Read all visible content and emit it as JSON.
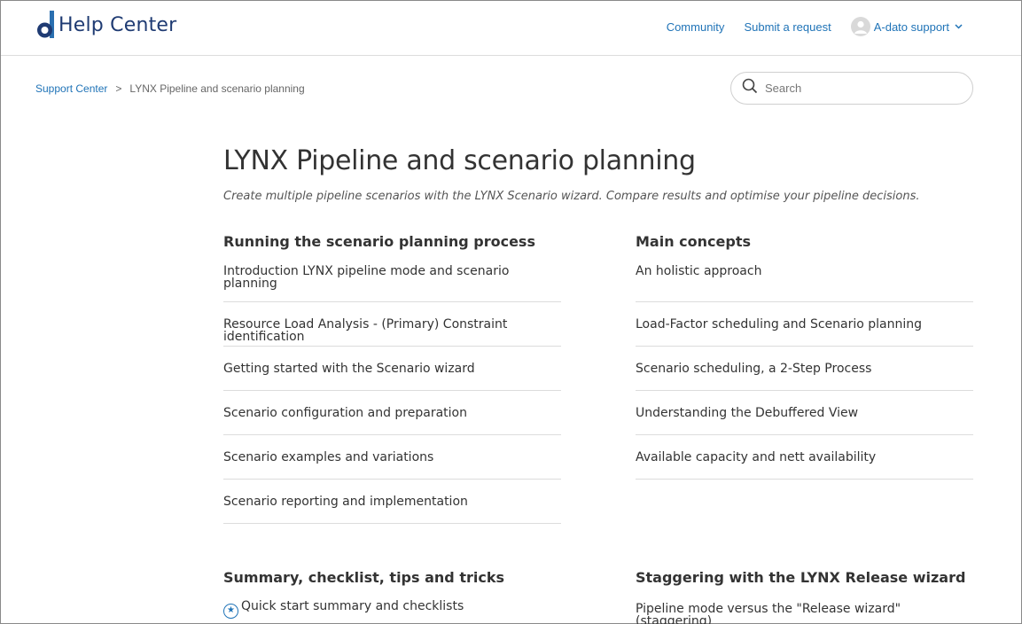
{
  "header": {
    "logo_text": "Help Center",
    "nav": {
      "community": "Community",
      "submit_request": "Submit a request",
      "user_name": "A-dato support"
    }
  },
  "breadcrumbs": {
    "home": "Support Center",
    "separator": ">",
    "current": "LYNX Pipeline and scenario planning"
  },
  "search": {
    "placeholder": "Search"
  },
  "category": {
    "title": "LYNX Pipeline and scenario planning",
    "description": "Create multiple pipeline scenarios with the LYNX Scenario wizard. Compare results and optimise your pipeline decisions."
  },
  "sections": [
    {
      "title": "Running the scenario planning process",
      "articles": [
        "Introduction LYNX pipeline mode and scenario planning",
        "Resource Load Analysis - (Primary) Constraint identification",
        "Getting started with the Scenario wizard",
        "Scenario configuration and preparation",
        "Scenario examples and variations",
        "Scenario reporting and implementation"
      ]
    },
    {
      "title": "Main concepts",
      "articles": [
        "An holistic approach",
        "Load-Factor scheduling and Scenario planning",
        "Scenario scheduling, a 2-Step Process",
        "Understanding the Debuffered View",
        "Available capacity and nett availability"
      ]
    },
    {
      "title": "Summary, checklist, tips and tricks",
      "articles": [
        "Quick start summary and checklists"
      ]
    },
    {
      "title": "Staggering with the LYNX Release wizard",
      "articles": [
        "Pipeline mode versus the \"Release wizard\" (staggering)"
      ]
    }
  ],
  "colors": {
    "link": "#1f73b7",
    "logo": "#1f3b73",
    "text": "#333333",
    "divider": "#dcdcdc"
  },
  "icons": {
    "promoted_article": "star-icon",
    "user": "avatar-icon",
    "search": "search-icon"
  }
}
